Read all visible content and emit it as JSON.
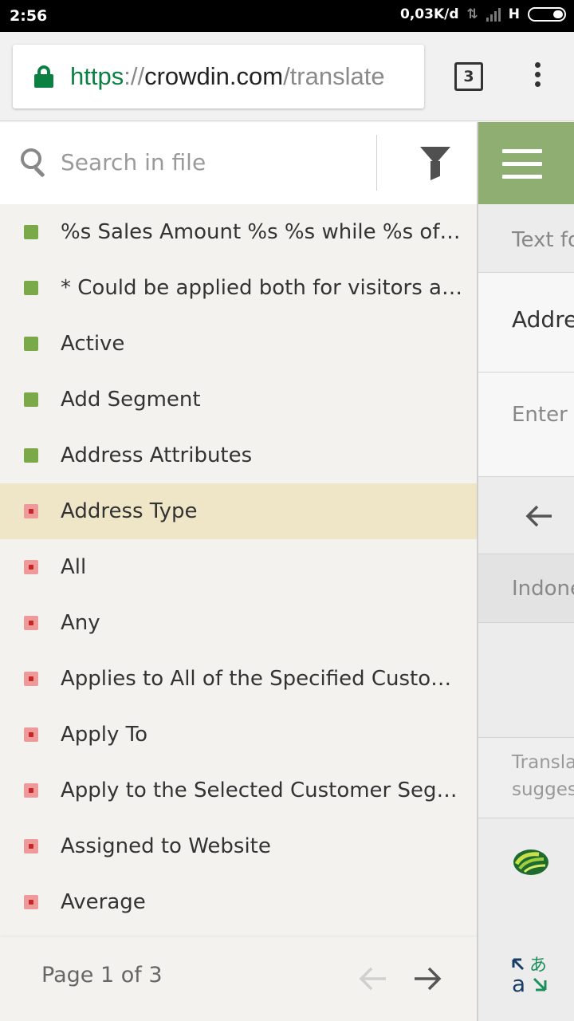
{
  "status_bar": {
    "time": "2:56",
    "network_speed": "0,03K/d",
    "network_type": "H"
  },
  "browser": {
    "url_scheme": "https",
    "url_separator": "://",
    "url_host": "crowdin.com",
    "url_path": "/translate",
    "tab_count": "3"
  },
  "search": {
    "placeholder": "Search in file"
  },
  "strings": [
    {
      "label": "%s Sales Amount %s %s while %s of these Conditions are %s:",
      "status": "done"
    },
    {
      "label": "* Could be applied both for visitors and registered customers",
      "status": "done"
    },
    {
      "label": "Active",
      "status": "done"
    },
    {
      "label": "Add Segment",
      "status": "done"
    },
    {
      "label": "Address Attributes",
      "status": "done"
    },
    {
      "label": "Address Type",
      "status": "todo",
      "selected": true
    },
    {
      "label": "All",
      "status": "todo"
    },
    {
      "label": "Any",
      "status": "todo"
    },
    {
      "label": "Applies to All of the Specified Customer Segments",
      "status": "todo"
    },
    {
      "label": "Apply To",
      "status": "todo"
    },
    {
      "label": "Apply to the Selected Customer Segments",
      "status": "todo"
    },
    {
      "label": "Assigned to Website",
      "status": "todo"
    },
    {
      "label": "Average",
      "status": "todo"
    }
  ],
  "pager": {
    "label": "Page 1 of 3"
  },
  "editor": {
    "context_label": "Text fo",
    "source_text": "Addre",
    "input_placeholder": "Enter t",
    "target_language": "Indone",
    "suggestions_line1": "Transla",
    "suggestions_line2": "suggest"
  },
  "colors": {
    "done": "#7aa949",
    "todo": "#ef9a9a",
    "selected_row": "#efe6c8",
    "accent_green": "#8fae72",
    "secure_green": "#0b8043"
  }
}
